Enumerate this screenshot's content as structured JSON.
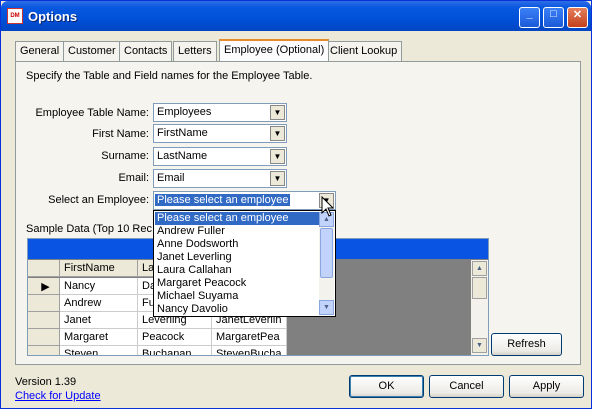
{
  "window": {
    "title": "Options",
    "app_icon_text": "DM"
  },
  "tabs": [
    {
      "label": "General"
    },
    {
      "label": "Customer"
    },
    {
      "label": "Contacts"
    },
    {
      "label": "Letters"
    },
    {
      "label": "Employee (Optional)",
      "active": true
    },
    {
      "label": "Client Lookup"
    }
  ],
  "instruction": "Specify the Table and Field names for the Employee Table.",
  "fields": {
    "table_name": {
      "label": "Employee Table Name:",
      "value": "Employees"
    },
    "first_name": {
      "label": "First Name:",
      "value": "FirstName"
    },
    "surname": {
      "label": "Surname:",
      "value": "LastName"
    },
    "email": {
      "label": "Email:",
      "value": "Email"
    },
    "employee": {
      "label": "Select an Employee:",
      "value": "Please select an employee"
    }
  },
  "dropdown_items": [
    "Please select an employee",
    "Andrew Fuller",
    "Anne Dodsworth",
    "Janet Leverling",
    "Laura Callahan",
    "Margaret Peacock",
    "Michael Suyama",
    "Nancy Davolio"
  ],
  "sample_label": "Sample Data (Top 10 Rec",
  "grid": {
    "columns": [
      "FirstName",
      "La",
      ""
    ],
    "rows": [
      [
        "Nancy",
        "Da",
        ""
      ],
      [
        "Andrew",
        "Fu",
        ""
      ],
      [
        "Janet",
        "Leverling",
        "JanetLeverlin"
      ],
      [
        "Margaret",
        "Peacock",
        "MargaretPea"
      ],
      [
        "Steven",
        "Buchanan",
        "StevenBucha"
      ]
    ]
  },
  "buttons": {
    "refresh": "Refresh",
    "ok": "OK",
    "cancel": "Cancel",
    "apply": "Apply"
  },
  "footer": {
    "version": "Version 1.39",
    "update_link": "Check for Update"
  },
  "colors": {
    "titlebar": "#0a58e0",
    "selection": "#316ac5",
    "grid_header": "#0a54e3"
  }
}
